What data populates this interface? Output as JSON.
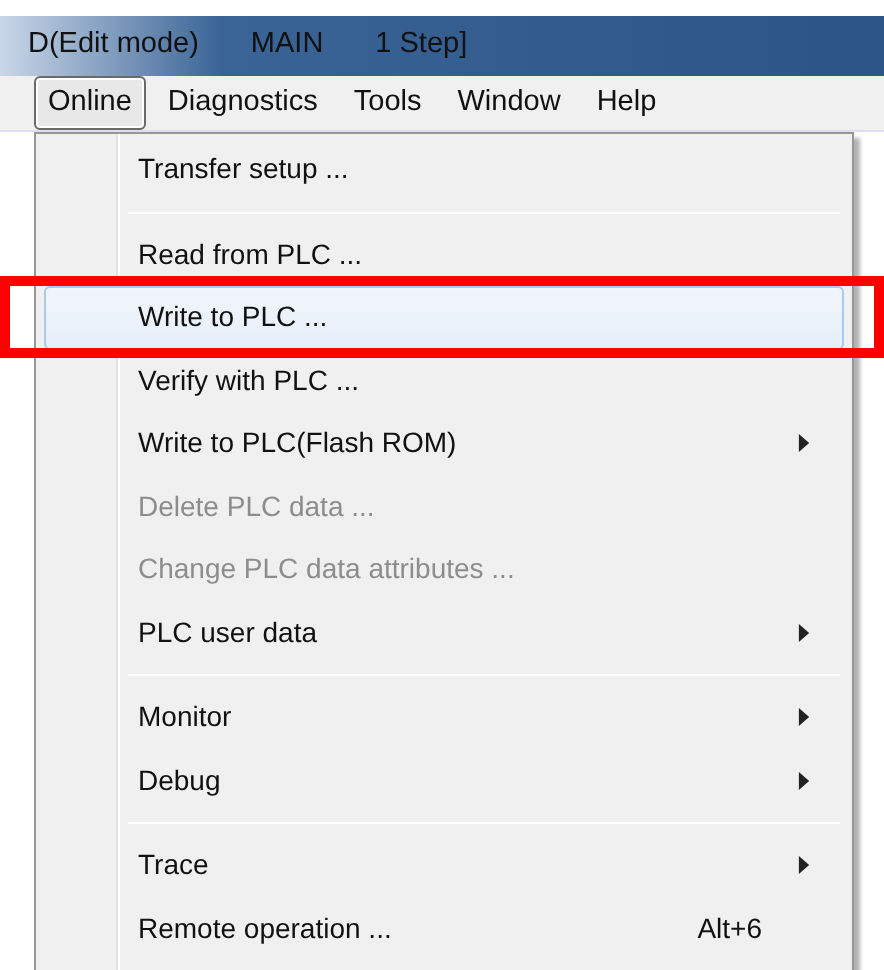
{
  "window": {
    "title_parts": [
      "D(Edit mode)",
      "MAIN",
      "1 Step]"
    ]
  },
  "menu_bar": [
    {
      "label": "Online",
      "selected": true
    },
    {
      "label": "Diagnostics",
      "selected": false
    },
    {
      "label": "Tools",
      "selected": false
    },
    {
      "label": "Window",
      "selected": false
    },
    {
      "label": "Help",
      "selected": false
    }
  ],
  "menu": [
    {
      "kind": "item",
      "label": "Transfer setup ...",
      "disabled": false,
      "submenu": false,
      "selected": false,
      "annotated": false
    },
    {
      "kind": "separator"
    },
    {
      "kind": "item",
      "label": "Read from PLC ...",
      "disabled": false,
      "submenu": false,
      "selected": false,
      "annotated": false
    },
    {
      "kind": "item",
      "label": "Write to PLC ...",
      "disabled": false,
      "submenu": false,
      "selected": true,
      "annotated": true
    },
    {
      "kind": "item",
      "label": "Verify with PLC ...",
      "disabled": false,
      "submenu": false,
      "selected": false,
      "annotated": false
    },
    {
      "kind": "item",
      "label": "Write to PLC(Flash ROM)",
      "disabled": false,
      "submenu": true,
      "selected": false,
      "annotated": false
    },
    {
      "kind": "item",
      "label": "Delete PLC data ...",
      "disabled": true,
      "submenu": false,
      "selected": false,
      "annotated": false
    },
    {
      "kind": "item",
      "label": "Change PLC data attributes ...",
      "disabled": true,
      "submenu": false,
      "selected": false,
      "annotated": false
    },
    {
      "kind": "item",
      "label": "PLC user data",
      "disabled": false,
      "submenu": true,
      "selected": false,
      "annotated": false
    },
    {
      "kind": "separator"
    },
    {
      "kind": "item",
      "label": "Monitor",
      "disabled": false,
      "submenu": true,
      "selected": false,
      "annotated": false
    },
    {
      "kind": "item",
      "label": "Debug",
      "disabled": false,
      "submenu": true,
      "selected": false,
      "annotated": false
    },
    {
      "kind": "separator"
    },
    {
      "kind": "item",
      "label": "Trace",
      "disabled": false,
      "submenu": true,
      "selected": false,
      "annotated": false
    },
    {
      "kind": "item",
      "label": "Remote operation ...",
      "shortcut": "Alt+6",
      "disabled": false,
      "submenu": false,
      "selected": false,
      "annotated": false
    }
  ]
}
